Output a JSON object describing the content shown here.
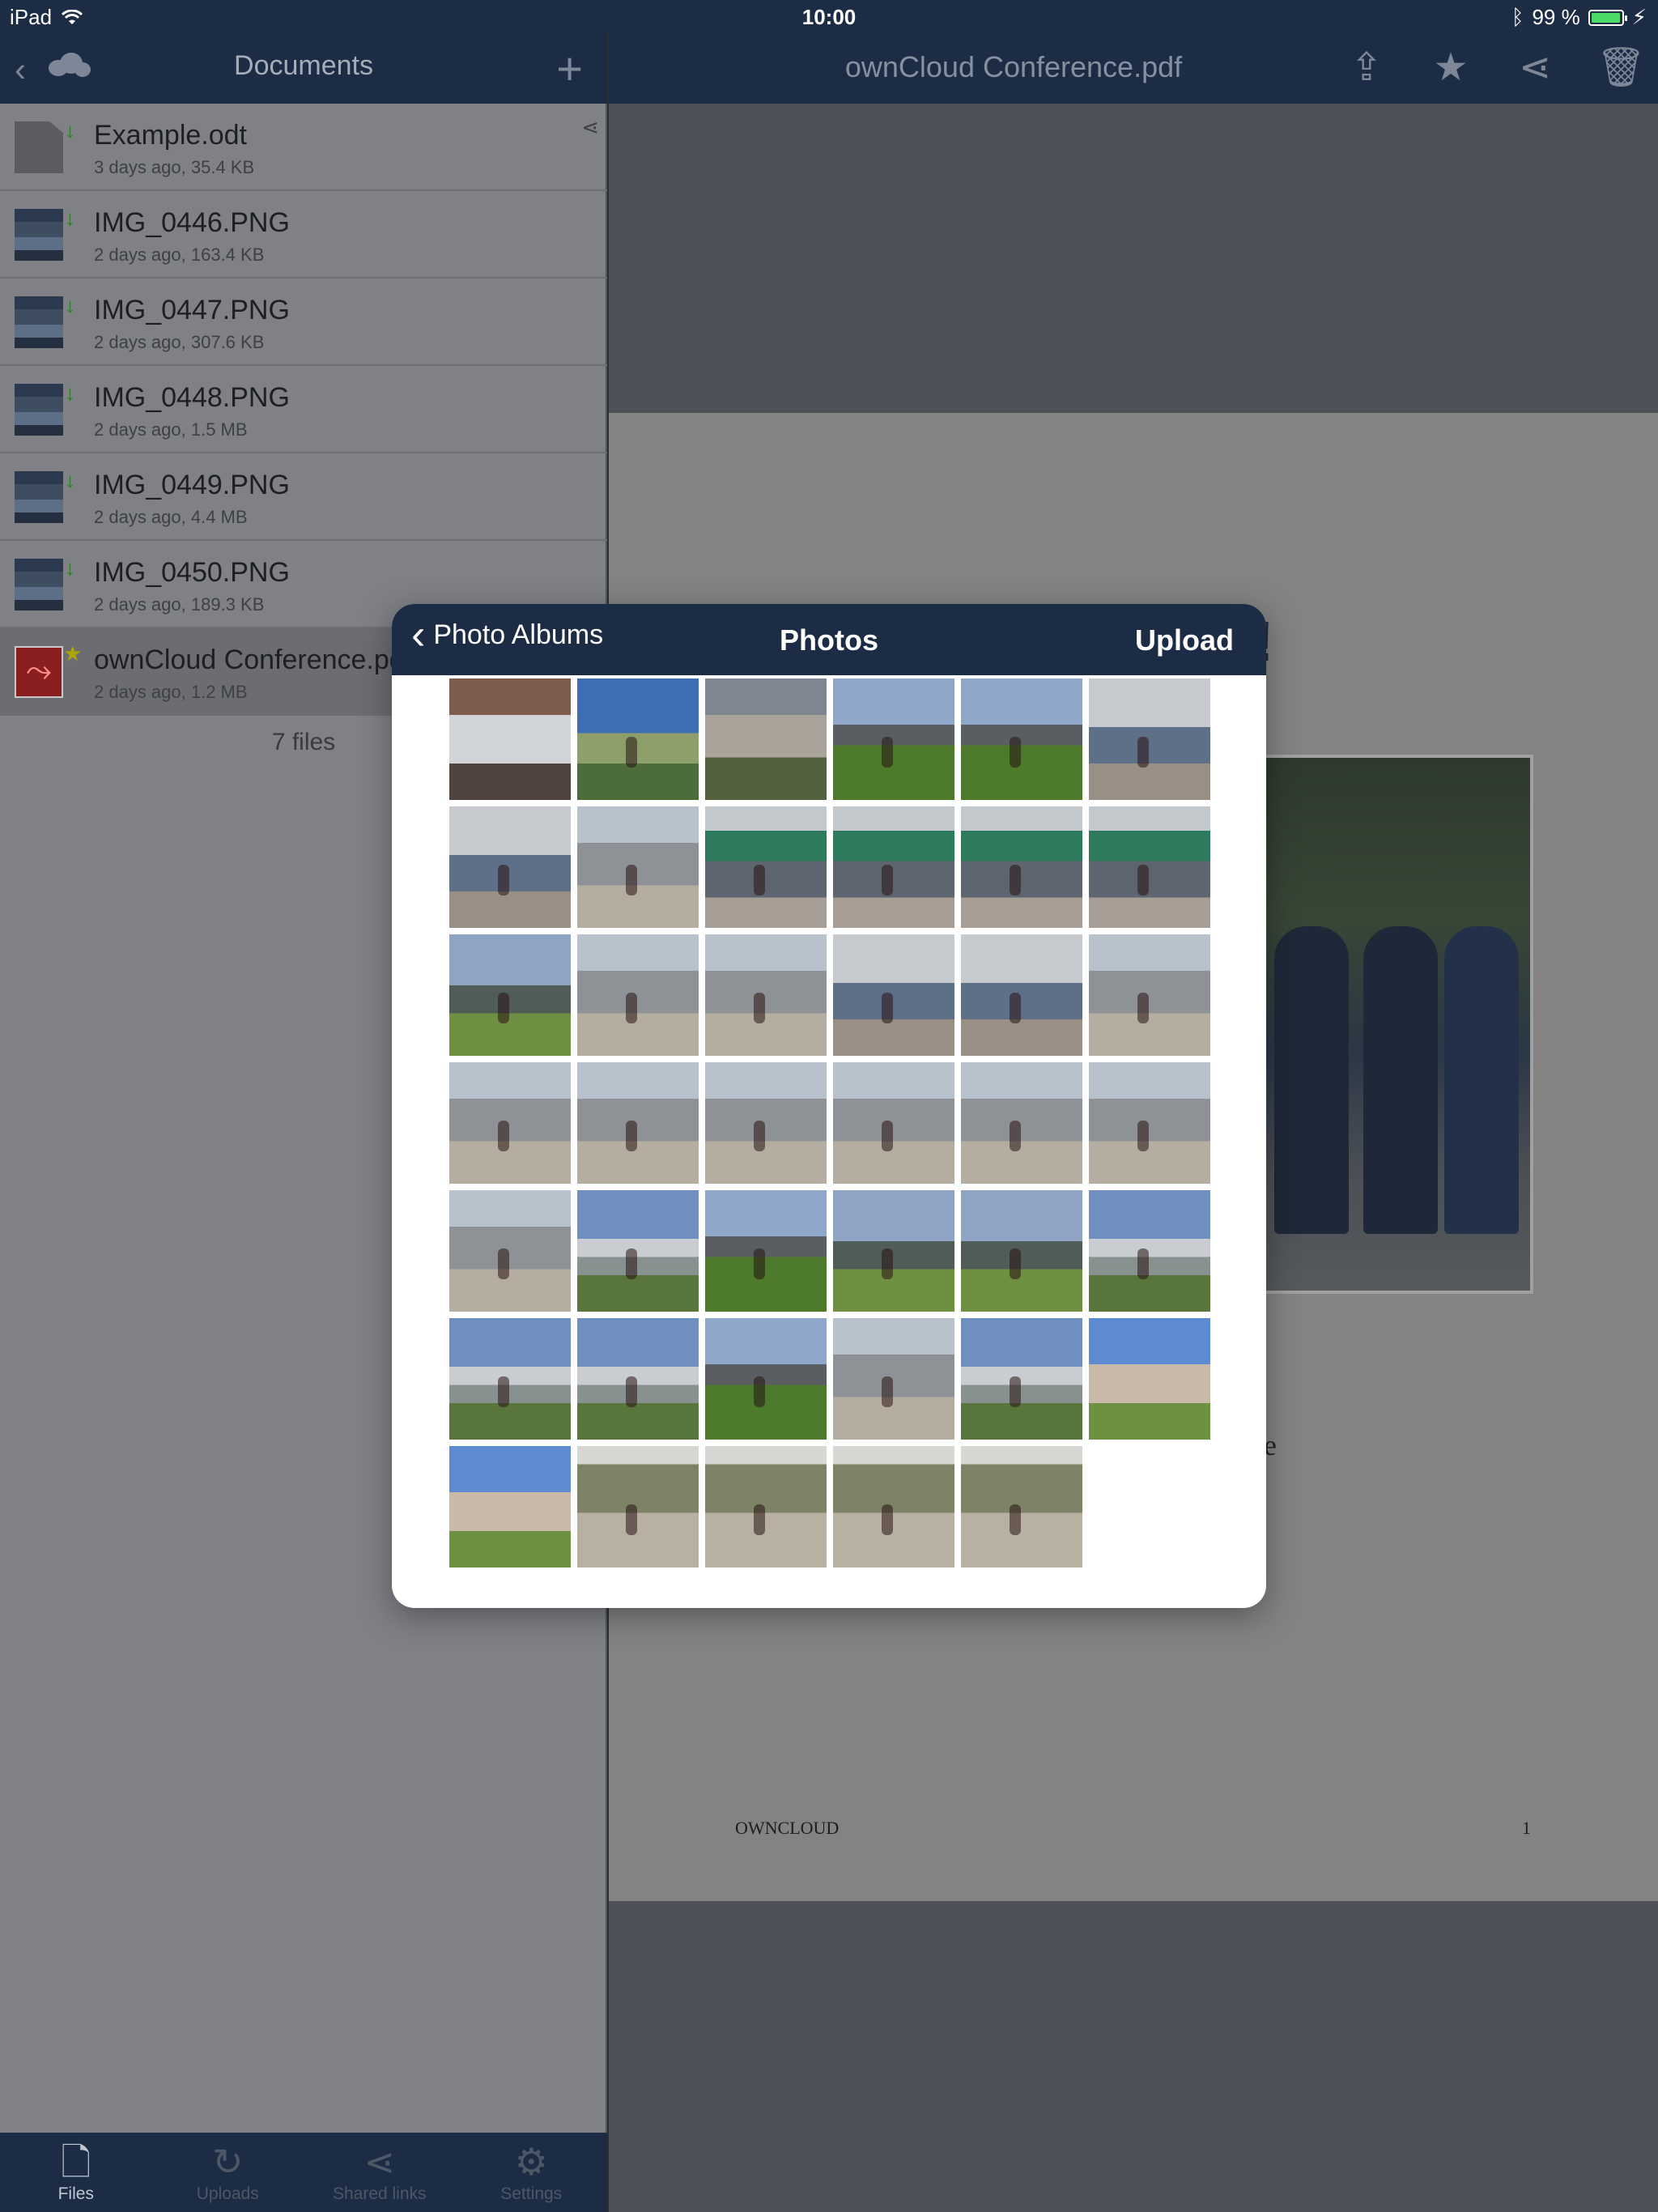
{
  "status_bar": {
    "device": "iPad",
    "time": "10:00",
    "battery": "99 %",
    "battery_level": 0.99
  },
  "sidebar": {
    "nav_title": "Documents",
    "files": [
      {
        "name": "Example.odt",
        "meta": "3 days ago, 35.4 KB",
        "icon": "document-icon",
        "downloaded": true,
        "shared": true
      },
      {
        "name": "IMG_0446.PNG",
        "meta": "2 days ago, 163.4 KB",
        "icon": "image-thumbnail",
        "downloaded": true
      },
      {
        "name": "IMG_0447.PNG",
        "meta": "2 days ago, 307.6 KB",
        "icon": "image-thumbnail",
        "downloaded": true
      },
      {
        "name": "IMG_0448.PNG",
        "meta": "2 days ago, 1.5 MB",
        "icon": "image-thumbnail",
        "downloaded": true
      },
      {
        "name": "IMG_0449.PNG",
        "meta": "2 days ago, 4.4 MB",
        "icon": "image-thumbnail",
        "downloaded": true
      },
      {
        "name": "IMG_0450.PNG",
        "meta": "2 days ago, 189.3 KB",
        "icon": "image-thumbnail",
        "downloaded": true
      },
      {
        "name": "ownCloud Conference.pdf",
        "meta": "2 days ago, 1.2 MB",
        "icon": "pdf-icon",
        "favorite": true,
        "selected": true
      }
    ],
    "file_count": "7 files",
    "tabs": [
      {
        "label": "Files",
        "icon": "file-icon",
        "active": true
      },
      {
        "label": "Uploads",
        "icon": "refresh-icon"
      },
      {
        "label": "Shared links",
        "icon": "share-icon"
      },
      {
        "label": "Settings",
        "icon": "gear-icon"
      }
    ]
  },
  "main": {
    "nav_title": "ownCloud Conference.pdf",
    "actions": [
      "share-out-icon",
      "star-icon",
      "share-icon",
      "trash-icon"
    ],
    "pdf": {
      "footer_left": "OWNCLOUD",
      "footer_right": "1",
      "fragment": "ce",
      "heading_fragment": "!"
    }
  },
  "popover": {
    "back_label": "Photo Albums",
    "title": "Photos",
    "upload_label": "Upload",
    "photo_count": 41
  },
  "colors": {
    "nav_bar": "#1c2c44",
    "dim_sidebar": "#7f8187",
    "accent_green": "#2f7d22"
  }
}
